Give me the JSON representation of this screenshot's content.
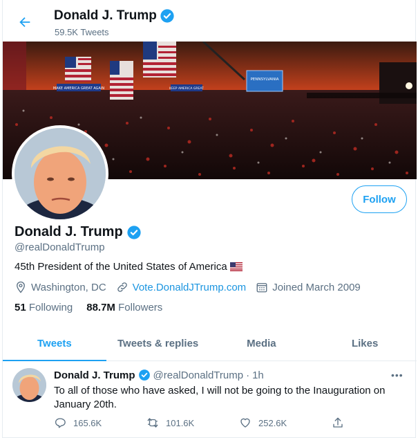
{
  "header": {
    "title": "Donald J. Trump",
    "tweet_count": "59.5K Tweets"
  },
  "banner": {
    "sign_left": "MAKE AMERICA GREAT AGAIN",
    "sign_mid": "KEEP AMERICA GREAT",
    "sign_right": "PENNSYLVANIA"
  },
  "profile": {
    "name": "Donald J. Trump",
    "handle": "@realDonaldTrump",
    "bio": "45th President of the United States of America",
    "location": "Washington, DC",
    "website": "Vote.DonaldJTrump.com",
    "joined": "Joined March 2009",
    "following_count": "51",
    "following_label": "Following",
    "followers_count": "88.7M",
    "followers_label": "Followers",
    "follow_label": "Follow"
  },
  "tabs": [
    {
      "label": "Tweets",
      "active": true
    },
    {
      "label": "Tweets & replies",
      "active": false
    },
    {
      "label": "Media",
      "active": false
    },
    {
      "label": "Likes",
      "active": false
    }
  ],
  "tweet": {
    "name": "Donald J. Trump",
    "handle": "@realDonaldTrump",
    "separator": "·",
    "time": "1h",
    "more": "•••",
    "text": "To all of those who have asked, I will not be going to the Inauguration on January 20th.",
    "replies": "165.6K",
    "retweets": "101.6K",
    "likes": "252.6K"
  },
  "colors": {
    "accent": "#1da1f2",
    "link": "#1b95e0",
    "secondary_text": "#5b7083",
    "verified": "#1da1f2"
  },
  "icons": [
    "back-arrow-icon",
    "verified-badge-icon",
    "location-pin-icon",
    "link-icon",
    "calendar-icon",
    "reply-icon",
    "retweet-icon",
    "like-icon",
    "share-icon",
    "more-icon",
    "us-flag-emoji"
  ]
}
